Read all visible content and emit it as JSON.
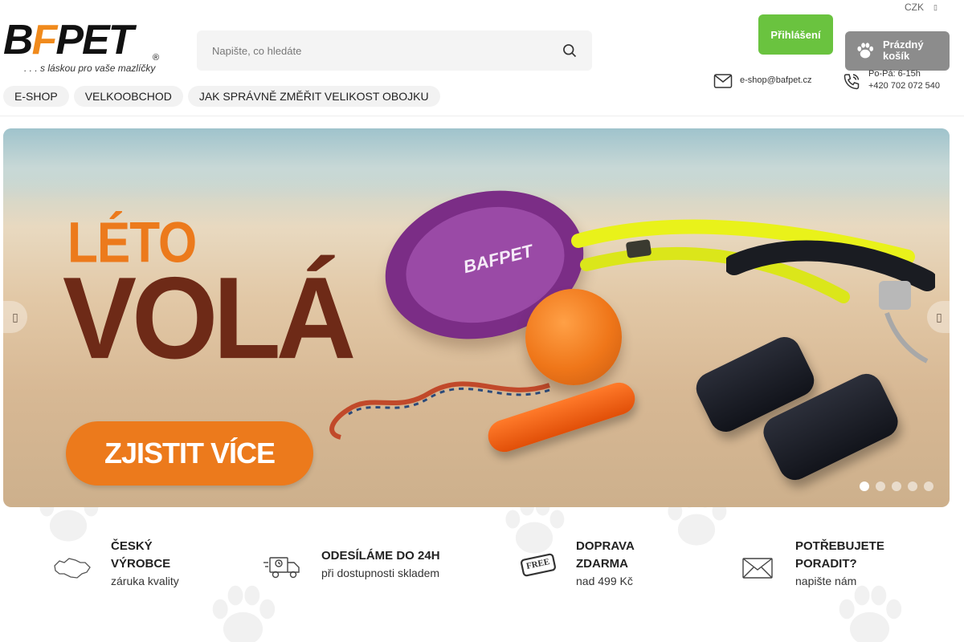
{
  "header": {
    "logo": {
      "wordmark_black": "B",
      "wordmark_orange": "F",
      "wordmark_rest": "PET",
      "registered": "®",
      "tagline": ". . . s láskou pro vaše mazlíčky"
    },
    "search": {
      "placeholder": "Napište, co hledáte",
      "icon": "search-icon"
    },
    "currency": "CZK",
    "login_label": "Přihlášení",
    "cart_label": "Prázdný košík",
    "contact": {
      "email": "e-shop@bafpet.cz",
      "hours": "Po-Pá: 6-15h",
      "phone": "+420 702 072 540"
    },
    "nav": [
      {
        "label": "E-SHOP"
      },
      {
        "label": "VELKOOBCHOD"
      },
      {
        "label": "JAK SPRÁVNĚ ZMĚŘIT VELIKOST OBOJKU"
      }
    ]
  },
  "hero": {
    "title_small": "LÉTO",
    "title_big": "VOLÁ",
    "cta_label": "ZJISTIT VÍCE",
    "product_text": "BAFPET",
    "slides_count": 5,
    "active_slide": 1
  },
  "features": [
    {
      "icon": "czech-map-icon",
      "title_line1": "ČESKÝ",
      "title_line2": "VÝROBCE",
      "subtitle": "záruka kvality"
    },
    {
      "icon": "delivery-truck-icon",
      "title_line1": "ODESÍLÁME DO 24H",
      "title_line2": "",
      "subtitle": "při dostupnosti skladem"
    },
    {
      "icon": "free-badge-icon",
      "badge_text": "FREE",
      "title_line1": "DOPRAVA",
      "title_line2": "ZDARMA",
      "subtitle": "nad 499 Kč"
    },
    {
      "icon": "envelope-icon",
      "title_line1": "POTŘEBUJETE",
      "title_line2": "PORADIT?",
      "subtitle": "napište nám"
    }
  ],
  "colors": {
    "brand_orange": "#f08a1c",
    "login_green": "#6ac33f",
    "cart_gray": "#8c8c8c",
    "hero_brown": "#6e2a17",
    "cta_orange": "#ec7a1c"
  }
}
